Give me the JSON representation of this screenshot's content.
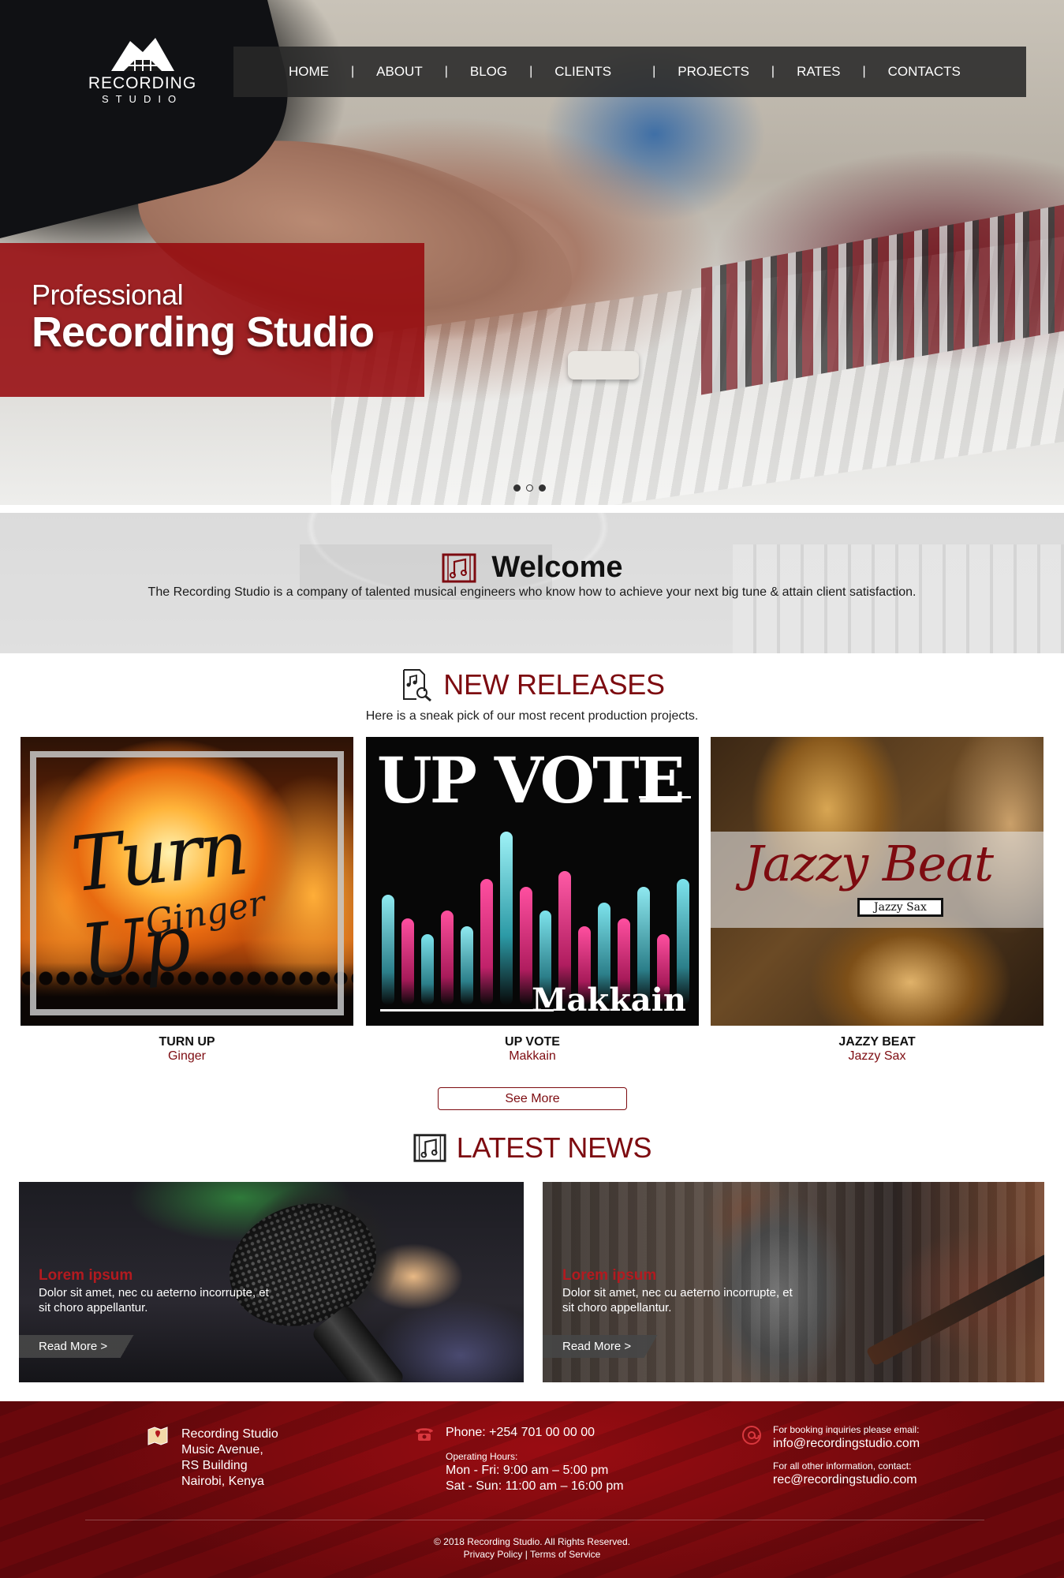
{
  "brand": {
    "name": "RECORDING",
    "tagline": "STUDIO"
  },
  "nav": {
    "items": [
      {
        "label": "HOME"
      },
      {
        "label": "ABOUT"
      },
      {
        "label": "BLOG"
      },
      {
        "label": "CLIENTS"
      },
      {
        "label": "PROJECTS"
      },
      {
        "label": "RATES"
      },
      {
        "label": "CONTACTS"
      }
    ],
    "separator": "|"
  },
  "hero": {
    "line1": "Professional",
    "line2": "Recording Studio",
    "slides": 3,
    "active_slide": 2
  },
  "welcome": {
    "title": "Welcome",
    "text": "The Recording Studio is a company of talented musical engineers who know how to achieve your next big tune & attain client satisfaction.",
    "icon": "music-note-icon"
  },
  "releases": {
    "title": "NEW RELEASES",
    "subtitle": "Here is a sneak pick of our most recent production projects.",
    "icon": "music-search-icon",
    "items": [
      {
        "title": "TURN UP",
        "artist": "Ginger",
        "cover_text": "Turn Up",
        "cover_sub": "Ginger"
      },
      {
        "title": "UP VOTE",
        "artist": "Makkain",
        "cover_text": "UP VOTE",
        "cover_sub": "Makkain"
      },
      {
        "title": "JAZZY BEAT",
        "artist": "Jazzy Sax",
        "cover_text": "Jazzy Beat",
        "cover_sub": "Jazzy Sax"
      }
    ],
    "see_more": "See More"
  },
  "news": {
    "title": "LATEST NEWS",
    "icon": "music-note-icon",
    "items": [
      {
        "heading": "Lorem ipsum",
        "body": "Dolor sit amet, nec cu aeterno incorrupte, et sit choro appellantur.",
        "link": "Read More >"
      },
      {
        "heading": "Lorem ipsum",
        "body": "Dolor sit amet, nec cu aeterno incorrupte, et sit choro appellantur.",
        "link": "Read More >"
      }
    ]
  },
  "footer": {
    "address": [
      "Recording Studio",
      "Music Avenue,",
      "RS Building",
      "Nairobi, Kenya"
    ],
    "phone": "Phone: +254 701 00 00 00",
    "hours_label": "Operating Hours:",
    "hours": [
      "Mon - Fri: 9:00 am – 5:00 pm",
      "Sat - Sun: 11:00 am – 16:00 pm"
    ],
    "booking_label": "For booking inquiries please email:",
    "booking_email": "info@recordingstudio.com",
    "other_label": "For all other information, contact:",
    "other_email": "rec@recordingstudio.com",
    "copyright": "© 2018 Recording Studio. All Rights Reserved.",
    "privacy": "Privacy Policy",
    "legal_sep": "|",
    "terms": "Terms of Service",
    "icons": [
      "map-icon",
      "phone-icon",
      "email-icon"
    ]
  },
  "colors": {
    "brand_red": "#7d0b10",
    "accent_red": "#b31a1f",
    "nav_bg": "#282828"
  }
}
